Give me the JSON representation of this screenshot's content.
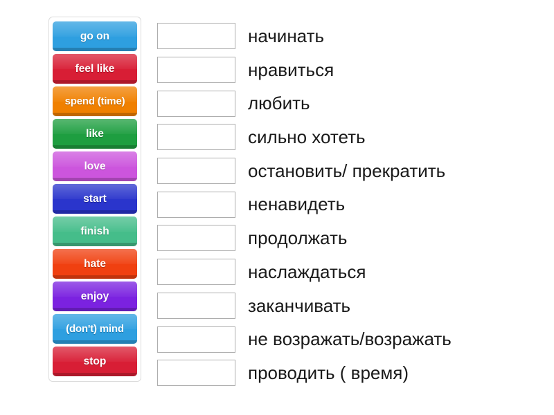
{
  "activity": {
    "type": "match-up",
    "tiles": [
      {
        "label": "go on",
        "color": "#2e9fe0"
      },
      {
        "label": "feel like",
        "color": "#d81e35"
      },
      {
        "label": "spend (time)",
        "color": "#f08000"
      },
      {
        "label": "like",
        "color": "#1e9e40"
      },
      {
        "label": "love",
        "color": "#cc55dd"
      },
      {
        "label": "start",
        "color": "#2a35cc"
      },
      {
        "label": "finish",
        "color": "#45bd8a"
      },
      {
        "label": "hate",
        "color": "#f04010"
      },
      {
        "label": "enjoy",
        "color": "#7b22e0"
      },
      {
        "label": "(don't) mind",
        "color": "#2e9fe0"
      },
      {
        "label": "stop",
        "color": "#d81e35"
      }
    ],
    "answers": [
      {
        "text": "начинать"
      },
      {
        "text": "нравиться"
      },
      {
        "text": "любить"
      },
      {
        "text": "сильно хотеть"
      },
      {
        "text": "остановить/ прекратить"
      },
      {
        "text": "ненавидеть"
      },
      {
        "text": "продолжать"
      },
      {
        "text": "наслаждаться"
      },
      {
        "text": "заканчивать"
      },
      {
        "text": "не возражать/возражать"
      },
      {
        "text": "проводить ( время)"
      }
    ],
    "drop_zone_value": ""
  }
}
